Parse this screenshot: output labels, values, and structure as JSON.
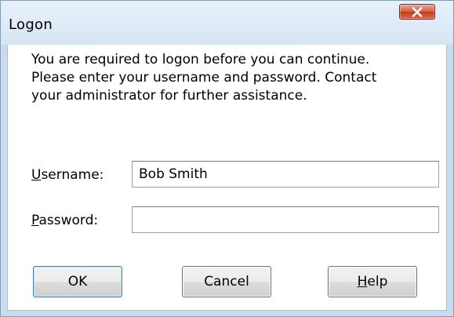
{
  "window": {
    "title": "Logon"
  },
  "message": {
    "lines": [
      "You are required to logon before you can continue.",
      "Please enter your username and password. Contact",
      "your administrator for further assistance."
    ]
  },
  "username": {
    "label_mnemonic": "U",
    "label_rest": "sername:",
    "value": "Bob Smith"
  },
  "password": {
    "label_mnemonic": "P",
    "label_rest": "assword:",
    "value": ""
  },
  "buttons": {
    "ok": "OK",
    "cancel": "Cancel",
    "help_mnemonic": "H",
    "help_rest": "elp"
  },
  "icons": {
    "close": "close-icon"
  },
  "colors": {
    "titlebar": "#dbe8f5",
    "close_button": "#c9472a",
    "default_button_border": "#3c7fb1"
  }
}
